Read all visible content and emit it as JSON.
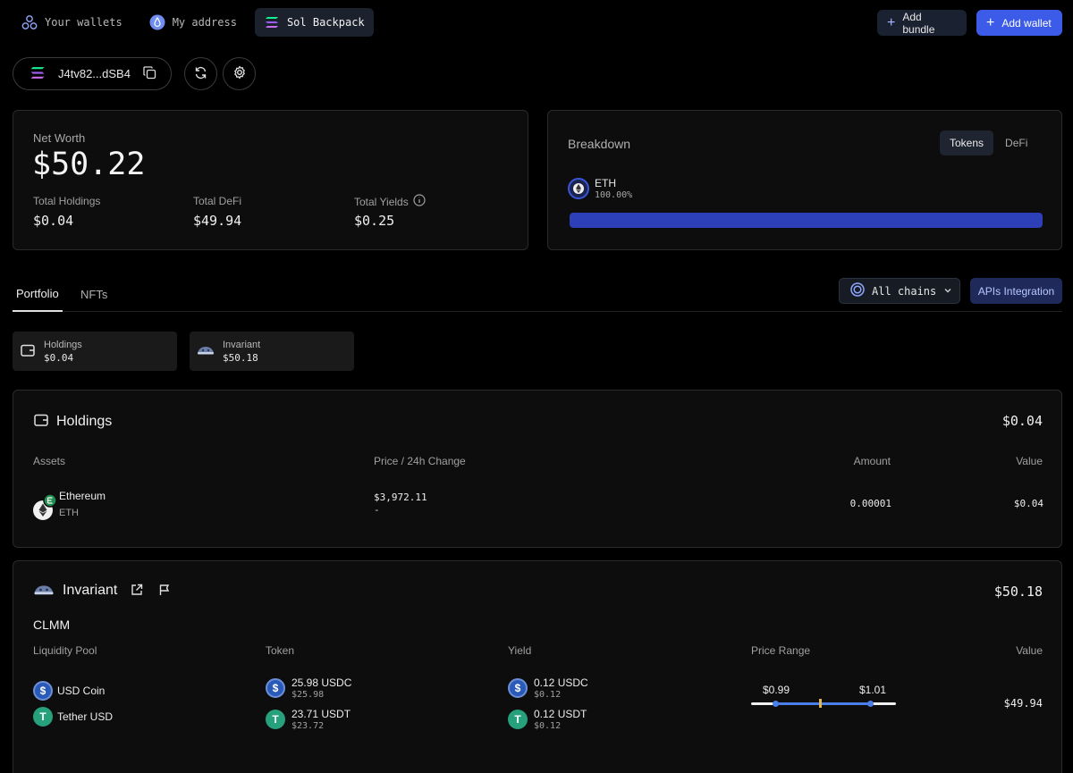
{
  "nav": {
    "tabs": [
      {
        "label": "Your wallets"
      },
      {
        "label": "My address"
      },
      {
        "label": "Sol Backpack"
      }
    ],
    "add_bundle_label": "Add bundle",
    "add_wallet_label": "Add wallet"
  },
  "wallet": {
    "address": "J4tv82...dSB4"
  },
  "summary": {
    "net_worth_label": "Net Worth",
    "net_worth_value": "$50.22",
    "total_holdings_label": "Total Holdings",
    "total_holdings_value": "$0.04",
    "total_defi_label": "Total DeFi",
    "total_defi_value": "$49.94",
    "total_yields_label": "Total Yields",
    "total_yields_value": "$0.25"
  },
  "breakdown": {
    "title": "Breakdown",
    "tabs": [
      "Tokens",
      "DeFi"
    ],
    "items": [
      {
        "symbol": "ETH",
        "percent": "100.00%",
        "share": 1.0
      }
    ],
    "bar_color": "#2e40b8"
  },
  "main_tabs": {
    "portfolio_label": "Portfolio",
    "nfts_label": "NFTs",
    "chains_label": "All chains",
    "apis_label": "APIs Integration"
  },
  "mini_cards": [
    {
      "name": "Holdings",
      "value": "$0.04"
    },
    {
      "name": "Invariant",
      "value": "$50.18"
    }
  ],
  "holdings": {
    "title": "Holdings",
    "total": "$0.04",
    "headers": {
      "assets": "Assets",
      "price": "Price / 24h Change",
      "amount": "Amount",
      "value": "Value"
    },
    "rows": [
      {
        "name": "Ethereum",
        "symbol": "ETH",
        "price": "$3,972.11",
        "change": "-",
        "amount": "0.00001",
        "value": "$0.04"
      }
    ]
  },
  "invariant": {
    "title": "Invariant",
    "total": "$50.18",
    "section": "CLMM",
    "headers": {
      "pool": "Liquidity Pool",
      "token": "Token",
      "yield": "Yield",
      "range": "Price Range",
      "value": "Value"
    },
    "pool_tokens": [
      "USD Coin",
      "Tether USD"
    ],
    "tokens": [
      {
        "amount": "25.98 USDC",
        "usd": "$25.98"
      },
      {
        "amount": "23.71 USDT",
        "usd": "$23.72"
      }
    ],
    "yields": [
      {
        "amount": "0.12 USDC",
        "usd": "$0.12"
      },
      {
        "amount": "0.12 USDT",
        "usd": "$0.12"
      }
    ],
    "range_low": "$0.99",
    "range_high": "$1.01",
    "value": "$49.94"
  },
  "colors": {
    "accent": "#3c5be8",
    "range_blue": "#4a7ee8",
    "range_marker": "#e0b84a"
  }
}
